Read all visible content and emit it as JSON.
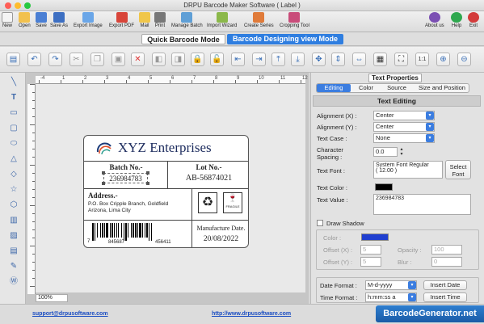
{
  "app": {
    "title": "DRPU Barcode Maker Software ( Label )"
  },
  "toolbar": {
    "items": [
      {
        "label": "New",
        "icon": "new-icon"
      },
      {
        "label": "Open",
        "icon": "open-icon"
      },
      {
        "label": "Save",
        "icon": "save-icon"
      },
      {
        "label": "Save As",
        "icon": "save-as-icon"
      },
      {
        "label": "Export Image",
        "icon": "export-image-icon"
      },
      {
        "label": "Export PDF",
        "icon": "export-pdf-icon"
      },
      {
        "label": "Mail",
        "icon": "mail-icon"
      },
      {
        "label": "Print",
        "icon": "print-icon"
      },
      {
        "label": "Manage Batch",
        "icon": "manage-batch-icon"
      },
      {
        "label": "Import Wizard",
        "icon": "import-wizard-icon"
      },
      {
        "label": "Create Series",
        "icon": "create-series-icon"
      },
      {
        "label": "Cropping Tool",
        "icon": "cropping-tool-icon"
      }
    ],
    "right": [
      {
        "label": "About us",
        "icon": "about-icon"
      },
      {
        "label": "Help",
        "icon": "help-icon"
      },
      {
        "label": "Exit",
        "icon": "exit-icon"
      }
    ]
  },
  "modes": {
    "quick": "Quick Barcode Mode",
    "designing": "Barcode Designing view Mode"
  },
  "canvas": {
    "zoom": "100%",
    "ruler_marks": [
      "-4",
      "1",
      "2",
      "3",
      "4",
      "5",
      "6",
      "7",
      "8",
      "9",
      "10",
      "11",
      "12"
    ]
  },
  "label": {
    "company": "XYZ Enterprises",
    "batch_title": "Batch No.-",
    "batch_value": "236984783",
    "lot_title": "Lot No.-",
    "lot_value": "AB-56874021",
    "address_title": "Address.-",
    "address_line1": "P.O. Box Cripple Branch, Goldfield",
    "address_line2": "Arizona, Lima City",
    "fragile": "FRAGILE",
    "barcode_digits": [
      "7",
      "845687",
      "456411"
    ],
    "mfg_title": "Manufacture Date.",
    "mfg_value": "20/08/2022"
  },
  "panel": {
    "title": "Text Properties",
    "tabs": [
      "Editing",
      "Color",
      "Source",
      "Size and Position"
    ],
    "section": "Text Editing",
    "alignment_x_label": "Alignment (X) :",
    "alignment_x_value": "Center",
    "alignment_y_label": "Alignment (Y) :",
    "alignment_y_value": "Center",
    "text_case_label": "Text Case :",
    "text_case_value": "None",
    "char_spacing_label1": "Character",
    "char_spacing_label2": "Spacing :",
    "char_spacing_value": "0.0",
    "text_font_label": "Text Font :",
    "text_font_value1": "System Font Regular",
    "text_font_value2": "( 12.00 )",
    "select_font": "Select Font",
    "text_color_label": "Text Color :",
    "text_color": "#000000",
    "text_value_label": "Text Value :",
    "text_value": "236984783",
    "draw_shadow": "Draw Shadow",
    "shadow_color_label": "Color :",
    "shadow_color": "#1f3fd0",
    "offset_x_label": "Offset (X) :",
    "offset_x_value": "5",
    "offset_y_label": "Offset (Y) :",
    "offset_y_value": "5",
    "opacity_label": "Opacity :",
    "opacity_value": "100",
    "blur_label": "Blur :",
    "blur_value": "0",
    "date_format_label": "Date Format :",
    "date_format_value": "M-d-yyyy",
    "insert_date": "Insert Date",
    "time_format_label": "Time Format :",
    "time_format_value": "h:mm:ss a",
    "insert_time": "Insert Time"
  },
  "footer": {
    "email": "support@drpusoftware.com",
    "website": "http://www.drpusoftware.com",
    "brand": "BarcodeGenerator.net"
  },
  "colors": {
    "accent": "#3b7de0",
    "brand_bg": "#2a73c4",
    "mode_active": "#2f7ee0"
  }
}
